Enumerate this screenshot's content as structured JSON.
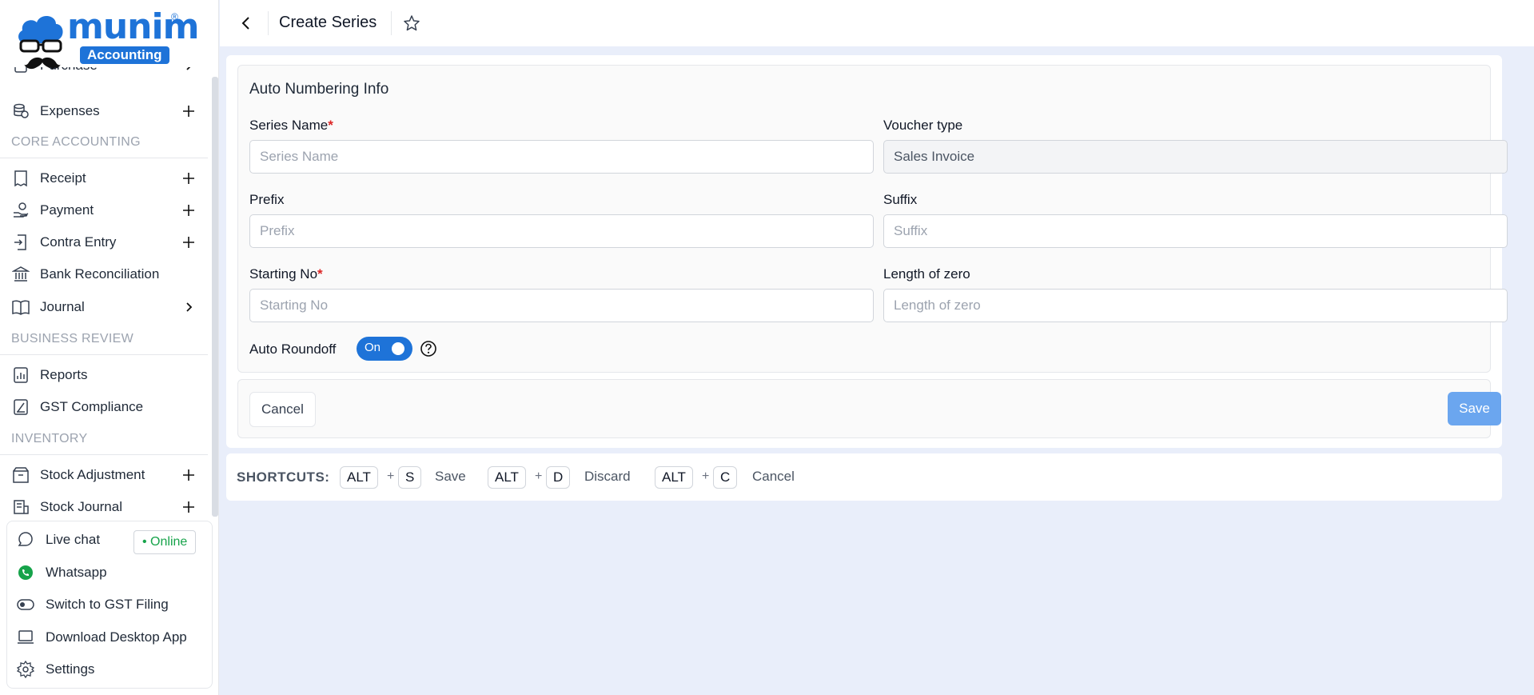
{
  "brand": {
    "word": "munim",
    "badge": "Accounting",
    "reg": "®",
    "color": "#1e73d8"
  },
  "header": {
    "title": "Create Series"
  },
  "sidebar": {
    "items": [
      {
        "label": "Purchase",
        "icon": "receipt-icon",
        "action": "chevron"
      },
      {
        "label": "Expenses",
        "icon": "coins-icon",
        "action": "plus"
      },
      {
        "label": "Receipt",
        "icon": "receipt-icon",
        "action": "plus"
      },
      {
        "label": "Payment",
        "icon": "hand-coin-icon",
        "action": "plus"
      },
      {
        "label": "Contra Entry",
        "icon": "contra-icon",
        "action": "plus"
      },
      {
        "label": "Bank Reconciliation",
        "icon": "bank-icon",
        "action": ""
      },
      {
        "label": "Journal",
        "icon": "book-icon",
        "action": "chevron"
      },
      {
        "label": "Reports",
        "icon": "chart-icon",
        "action": ""
      },
      {
        "label": "GST Compliance",
        "icon": "gst-icon",
        "action": ""
      },
      {
        "label": "Stock Adjustment",
        "icon": "box-icon",
        "action": "plus"
      },
      {
        "label": "Stock Journal",
        "icon": "stock-journal-icon",
        "action": "plus"
      }
    ],
    "sections": [
      "CORE ACCOUNTING",
      "BUSINESS REVIEW",
      "INVENTORY"
    ],
    "bottom": [
      {
        "label": "Live chat",
        "icon": "chat-icon"
      },
      {
        "label": "Whatsapp",
        "icon": "whatsapp-icon"
      },
      {
        "label": "Switch to GST Filing",
        "icon": "toggle-icon"
      },
      {
        "label": "Download Desktop App",
        "icon": "monitor-icon"
      },
      {
        "label": "Settings",
        "icon": "gear-icon"
      }
    ],
    "online": "• Online"
  },
  "form": {
    "section_title": "Auto Numbering Info",
    "series_name": {
      "label": "Series Name",
      "placeholder": "Series Name",
      "required": "*"
    },
    "voucher_type": {
      "label": "Voucher type",
      "value": "Sales Invoice"
    },
    "prefix": {
      "label": "Prefix",
      "placeholder": "Prefix"
    },
    "suffix": {
      "label": "Suffix",
      "placeholder": "Suffix"
    },
    "starting_no": {
      "label": "Starting No",
      "placeholder": "Starting No",
      "required": "*"
    },
    "length_of_zero": {
      "label": "Length of zero",
      "placeholder": "Length of zero"
    },
    "auto_roundoff": {
      "label": "Auto Roundoff",
      "state": "On"
    }
  },
  "actions": {
    "cancel": "Cancel",
    "save": "Save"
  },
  "shortcuts": {
    "title": "SHORTCUTS:",
    "items": [
      {
        "mod": "ALT",
        "plus": "+",
        "key": "S",
        "action": "Save"
      },
      {
        "mod": "ALT",
        "plus": "+",
        "key": "D",
        "action": "Discard"
      },
      {
        "mod": "ALT",
        "plus": "+",
        "key": "C",
        "action": "Cancel"
      }
    ]
  }
}
